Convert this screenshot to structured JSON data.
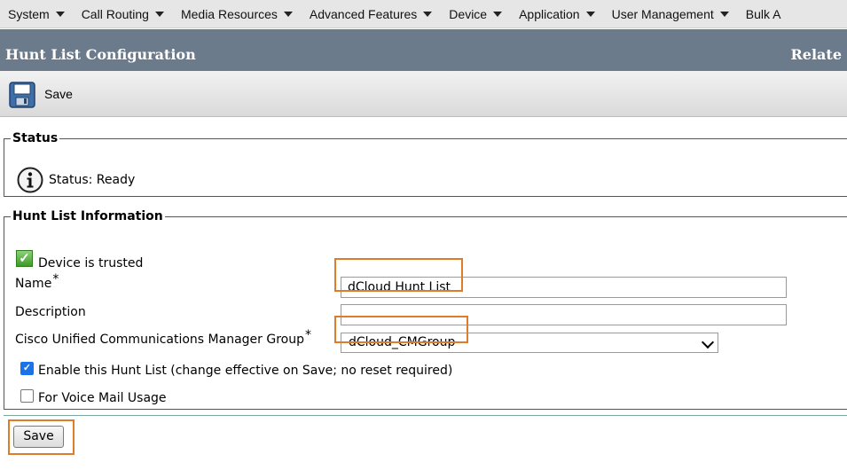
{
  "menu": {
    "items": [
      {
        "label": "System"
      },
      {
        "label": "Call Routing"
      },
      {
        "label": "Media Resources"
      },
      {
        "label": "Advanced Features"
      },
      {
        "label": "Device"
      },
      {
        "label": "Application"
      },
      {
        "label": "User Management"
      },
      {
        "label": "Bulk A"
      }
    ]
  },
  "header": {
    "title": "Hunt List Configuration",
    "related": "Relate"
  },
  "toolbar": {
    "save_label": "Save",
    "save_icon": "floppy-disk-icon"
  },
  "status": {
    "legend": "Status",
    "text": "Status: Ready",
    "icon": "info-icon"
  },
  "info": {
    "legend": "Hunt List Information",
    "device_trusted": "Device is trusted",
    "name_label": "Name",
    "name_value": "dCloud Hunt List",
    "description_label": "Description",
    "description_value": "",
    "cm_group_label": "Cisco Unified Communications Manager Group",
    "cm_group_value": "dCloud_CMGroup",
    "required_mark": "*",
    "enable_label": "Enable this Hunt List (change effective on Save; no reset required)",
    "enable_checked": true,
    "voicemail_label": "For Voice Mail Usage",
    "voicemail_checked": false
  },
  "footer": {
    "save_label": "Save"
  },
  "colors": {
    "highlight": "#e07b2a",
    "header_bg": "#6b7b8c",
    "checkbox_blue": "#1a73e8"
  }
}
